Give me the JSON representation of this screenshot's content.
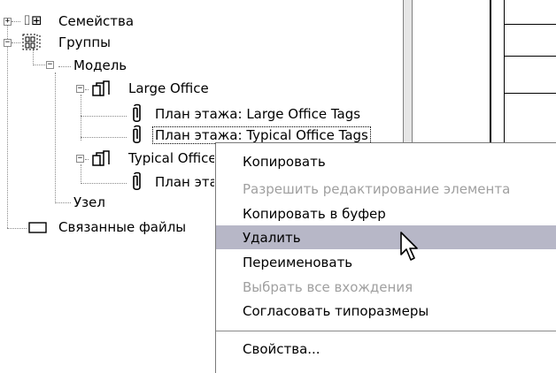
{
  "tree": {
    "items": [
      {
        "label": "Семейства",
        "expander": "+",
        "icon": "families-icon"
      },
      {
        "label": "Группы",
        "expander": "−",
        "icon": "groups-icon"
      },
      {
        "label": "Модель",
        "expander": "−"
      },
      {
        "label": "Large Office",
        "expander": "−",
        "icon": "group-model-icon"
      },
      {
        "label": "План этажа: Large Office Tags",
        "icon": "attached-detail-icon"
      },
      {
        "label": "План этажа: Typical Office Tags",
        "icon": "attached-detail-icon",
        "selected": true
      },
      {
        "label": "Typical Office",
        "expander": "−",
        "icon": "group-model-icon"
      },
      {
        "label": "План этажа: Typical Office Tags",
        "icon": "attached-detail-icon"
      },
      {
        "label": "Узел"
      },
      {
        "label": "Связанные файлы",
        "icon": "linked-files-icon"
      }
    ]
  },
  "context_menu": {
    "items": [
      {
        "label": "Копировать",
        "enabled": true
      },
      {
        "label": "Разрешить редактирование элемента",
        "enabled": false
      },
      {
        "label": "Копировать в буфер",
        "enabled": true
      },
      {
        "label": "Удалить",
        "enabled": true,
        "highlighted": true
      },
      {
        "label": "Переименовать",
        "enabled": true
      },
      {
        "label": "Выбрать все вхождения",
        "enabled": false
      },
      {
        "label": "Согласовать типоразмеры",
        "enabled": true
      },
      {
        "label": "Свойства...",
        "enabled": true
      }
    ]
  },
  "colors": {
    "menu_highlight": "#b7b7c7",
    "disabled_text": "#a0a0a0",
    "splitter": "#e6e6e6"
  },
  "icons": {
    "pointer": "mouse-pointer-icon"
  }
}
